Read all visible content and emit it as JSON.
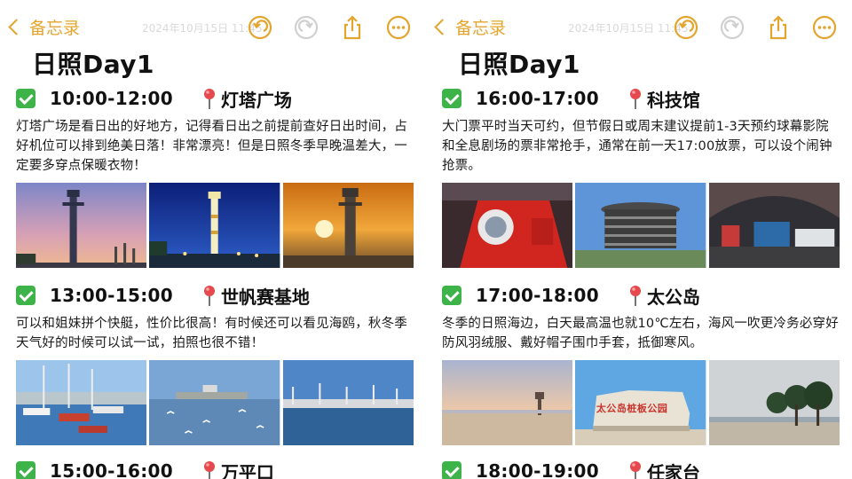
{
  "panes": [
    {
      "nav": {
        "back_label": "备忘录",
        "ghost_text": "2024年10月15日 11:45"
      },
      "title": "日照Day1",
      "sections": [
        {
          "time": "10:00-12:00",
          "place": "灯塔广场",
          "desc": "灯塔广场是看日出的好地方，记得看日出之前提前查好日出时间，占好机位可以排到绝美日落！非常漂亮！但是日照冬季早晚温差大，一定要多穿点保暖衣物！"
        },
        {
          "time": "13:00-15:00",
          "place": "世帆赛基地",
          "desc": "可以和姐妹拼个快艇，性价比很高！有时候还可以看见海鸥，秋冬季天气好的时候可以试一试，拍照也很不错！"
        },
        {
          "time": "15:00-16:00",
          "place": "万平口"
        }
      ]
    },
    {
      "nav": {
        "back_label": "备忘录",
        "ghost_text": "2024年10月15日 11:45"
      },
      "title": "日照Day1",
      "sections": [
        {
          "time": "16:00-17:00",
          "place": "科技馆",
          "desc": "大门票平时当天可约，但节假日或周末建议提前1-3天预约球幕影院和全息剧场的票非常抢手，通常在前一天17:00放票，可以设个闹钟抢票。"
        },
        {
          "time": "17:00-18:00",
          "place": "太公岛",
          "desc": "冬季的日照海边，白天最高温也就10℃左右，海风一吹更冷务必穿好防风羽绒服、戴好帽子围巾手套，抵御寒风。",
          "photo_sign": "太公岛桩板公园"
        },
        {
          "time": "18:00-19:00",
          "place": "任家台"
        }
      ]
    }
  ],
  "colors": {
    "accent": "#E3A52E",
    "check": "#3DB34A",
    "pin": "#E5484D"
  },
  "icons": [
    "undo-icon",
    "redo-icon",
    "share-icon",
    "more-icon",
    "checkmark-icon",
    "pin-icon"
  ]
}
